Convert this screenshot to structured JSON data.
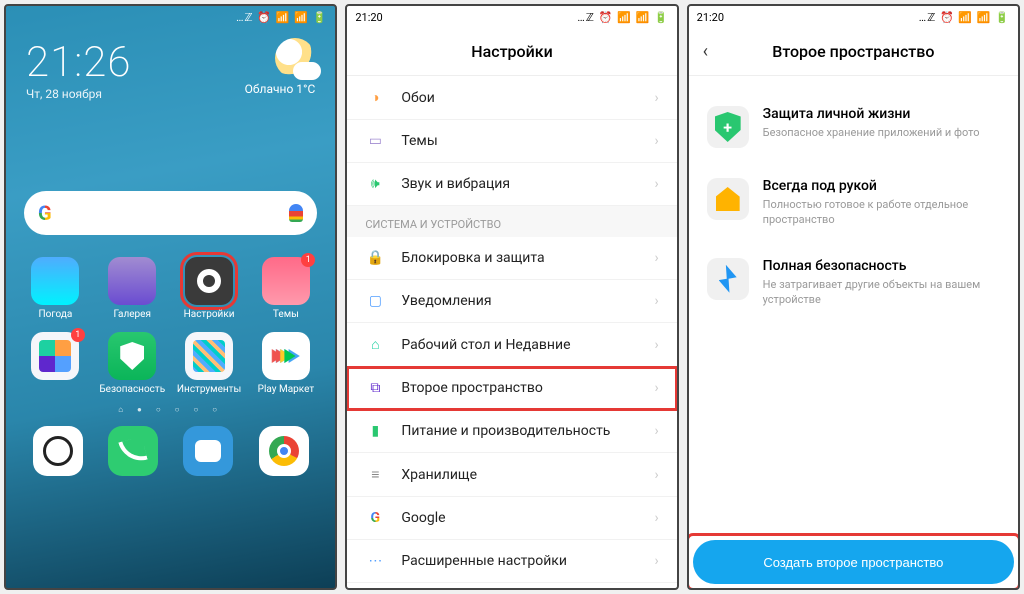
{
  "screen1": {
    "time": "21:26",
    "date": "Чт, 28 ноября",
    "weather_label": "Облачно",
    "weather_temp": "1°C",
    "apps": {
      "weather": "Погода",
      "gallery": "Галерея",
      "settings": "Настройки",
      "themes": "Темы",
      "tools": "",
      "security": "Безопасность",
      "instruments": "Инструменты",
      "playmarket": "Play Маркет"
    },
    "badge_tools": "1",
    "badge_themes": "1"
  },
  "screen2": {
    "status_time": "21:20",
    "title": "Настройки",
    "rows": {
      "wallpaper": "Обои",
      "themes": "Темы",
      "sound": "Звук и вибрация",
      "section": "СИСТЕМА И УСТРОЙСТВО",
      "lock": "Блокировка и защита",
      "notif": "Уведомления",
      "home": "Рабочий стол и Недавние",
      "second_space": "Второе пространство",
      "power": "Питание и производительность",
      "storage": "Хранилище",
      "google": "Google",
      "advanced": "Расширенные настройки"
    }
  },
  "screen3": {
    "status_time": "21:20",
    "title": "Второе пространство",
    "feat1_title": "Защита личной жизни",
    "feat1_desc": "Безопасное хранение приложений и фото",
    "feat2_title": "Всегда под рукой",
    "feat2_desc": "Полностью готовое к работе отдельное пространство",
    "feat3_title": "Полная безопасность",
    "feat3_desc": "Не затрагивает другие объекты на вашем устройстве",
    "cta": "Создать второе пространство"
  },
  "status_icons": "…ℤ ⏰ 📶 📶 🔋"
}
